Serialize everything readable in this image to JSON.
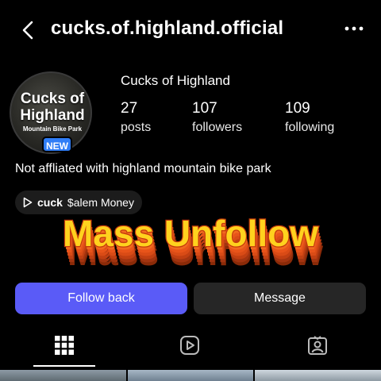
{
  "header": {
    "handle": "cucks.of.highland.official"
  },
  "profile": {
    "avatar_title": "Cucks of Highland",
    "avatar_subtitle": "Mountain Bike Park",
    "new_badge": "NEW",
    "display_name": "Cucks of Highland",
    "stats": [
      {
        "value": "27",
        "label": "posts"
      },
      {
        "value": "107",
        "label": "followers"
      },
      {
        "value": "109",
        "label": "following"
      }
    ],
    "bio": "Not affliated with highland mountain bike park",
    "music": {
      "song": "cuck",
      "artist": "$alem Money"
    }
  },
  "overlay_text": "Mass Unfollow",
  "actions": {
    "follow_back": "Follow back",
    "message": "Message"
  },
  "tabs": [
    "grid-icon",
    "reels-icon",
    "tagged-icon"
  ],
  "colors": {
    "background": "#000000",
    "follow_button": "#5a5bf7",
    "message_button": "#262626",
    "new_badge": "#2f7df6",
    "overlay_fill": "#ffd21e",
    "overlay_extrude": "#e8541a"
  }
}
